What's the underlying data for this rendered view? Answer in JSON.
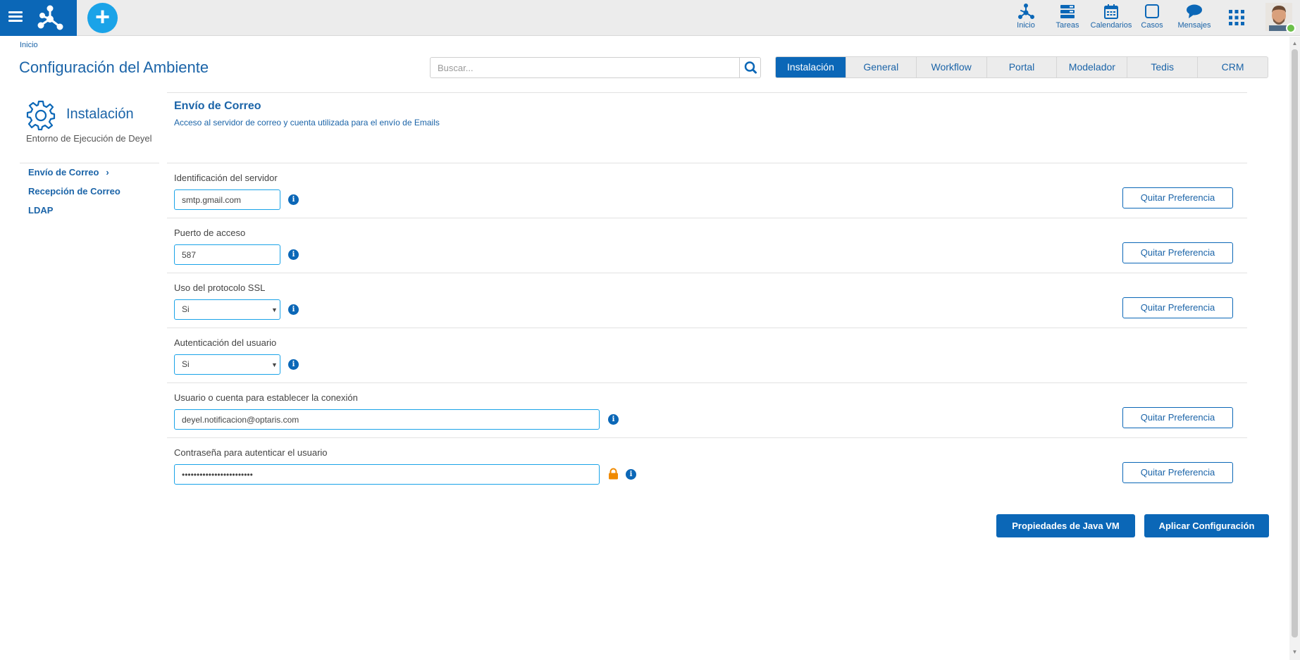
{
  "topbar": {
    "nav": [
      {
        "label": "Inicio",
        "icon": "home-network-icon"
      },
      {
        "label": "Tareas",
        "icon": "tasks-icon"
      },
      {
        "label": "Calendarios",
        "icon": "calendar-icon"
      },
      {
        "label": "Casos",
        "icon": "cases-icon"
      },
      {
        "label": "Mensajes",
        "icon": "messages-icon"
      }
    ],
    "add_symbol": "+"
  },
  "breadcrumb": "Inicio",
  "page_title": "Configuración del Ambiente",
  "search": {
    "placeholder": "Buscar...",
    "value": ""
  },
  "tabs": [
    {
      "label": "Instalación",
      "active": true
    },
    {
      "label": "General",
      "active": false
    },
    {
      "label": "Workflow",
      "active": false
    },
    {
      "label": "Portal",
      "active": false
    },
    {
      "label": "Modelador",
      "active": false
    },
    {
      "label": "Tedis",
      "active": false
    },
    {
      "label": "CRM",
      "active": false
    }
  ],
  "sidebar": {
    "title": "Instalación",
    "subtitle": "Entorno de Ejecución de Deyel",
    "items": [
      {
        "label": "Envío de Correo",
        "selected": true,
        "chevron": "›"
      },
      {
        "label": "Recepción de Correo",
        "selected": false
      },
      {
        "label": "LDAP",
        "selected": false
      }
    ]
  },
  "form": {
    "title": "Envío de Correo",
    "subtitle": "Acceso al servidor de correo y cuenta utilizada para el envío de Emails",
    "pref_button_label": "Quitar Preferencia",
    "fields": [
      {
        "label": "Identificación del servidor",
        "value": "smtp.gmail.com",
        "type": "text"
      },
      {
        "label": "Puerto de acceso",
        "value": "587",
        "type": "text"
      },
      {
        "label": "Uso del protocolo SSL",
        "value": "Si",
        "type": "select"
      },
      {
        "label": "Autenticación del usuario",
        "value": "Si",
        "type": "select"
      },
      {
        "label": "Usuario o cuenta para establecer la conexión",
        "value": "deyel.notificacion@optaris.com",
        "type": "text"
      },
      {
        "label": "Contraseña para autenticar el usuario",
        "value": "••••••••••••••••••••••••",
        "type": "password"
      }
    ],
    "info_glyph": "i"
  },
  "actions": {
    "java_vm": "Propiedades de Java VM",
    "apply": "Aplicar Configuración"
  },
  "colors": {
    "brand": "#0b67b7",
    "accent": "#1aa3e8",
    "online": "#6cc04a",
    "lock": "#f08a00"
  }
}
